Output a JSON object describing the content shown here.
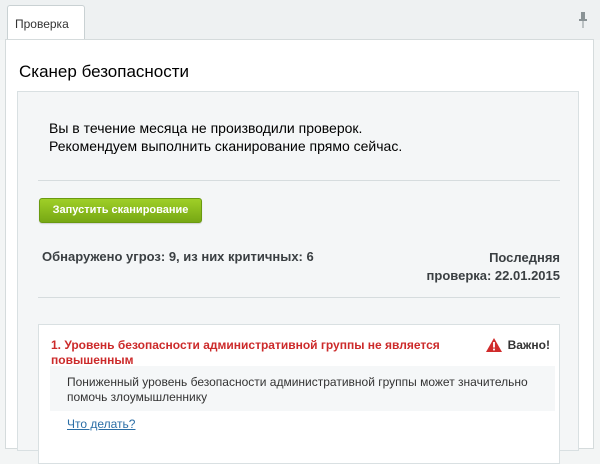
{
  "tab": {
    "label": "Проверка"
  },
  "panel": {
    "title": "Сканер безопасности"
  },
  "intro": {
    "text": "Вы в течение месяца не производили проверок.\nРекомендуем выполнить сканирование прямо сейчас."
  },
  "scan_button": {
    "label": "Запустить сканирование"
  },
  "summary": {
    "threats": "Обнаружено угроз: 9, из них критичных: 6",
    "last_check_line1": "Последняя",
    "last_check_line2": "проверка: 22.01.2015"
  },
  "issues": [
    {
      "title": "1. Уровень безопасности административной группы не является повышенным",
      "severity": "Важно!",
      "description": "Пониженный уровень безопасности административной группы может значительно помочь злоумышленнику",
      "action": "Что делать?"
    }
  ],
  "colors": {
    "accent_green": "#8cbf1d",
    "critical_red": "#cc2a2a",
    "link_blue": "#2b6ea6"
  }
}
